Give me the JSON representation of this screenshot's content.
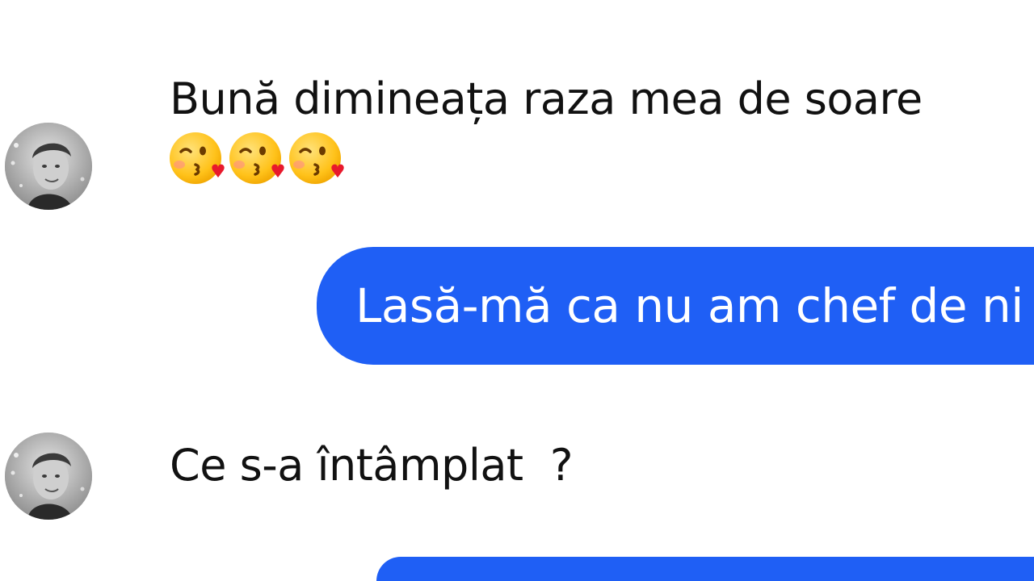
{
  "messages": [
    {
      "direction": "incoming",
      "text": "Bună dimineața raza mea de soare",
      "emojis": [
        "kissing-heart-emoji",
        "kissing-heart-emoji",
        "kissing-heart-emoji"
      ]
    },
    {
      "direction": "outgoing",
      "text": "Lasă-mă ca nu am chef de ni"
    },
    {
      "direction": "incoming",
      "text": "Ce s-a întâmplat  ?"
    },
    {
      "direction": "outgoing",
      "text": ""
    }
  ],
  "colors": {
    "outgoing_bubble": "#1f5ff5",
    "outgoing_text": "#ffffff",
    "incoming_text": "#111111",
    "background": "#ffffff"
  },
  "icons": {
    "avatar": "avatar-photo",
    "emoji": "kissing-face-with-heart"
  }
}
